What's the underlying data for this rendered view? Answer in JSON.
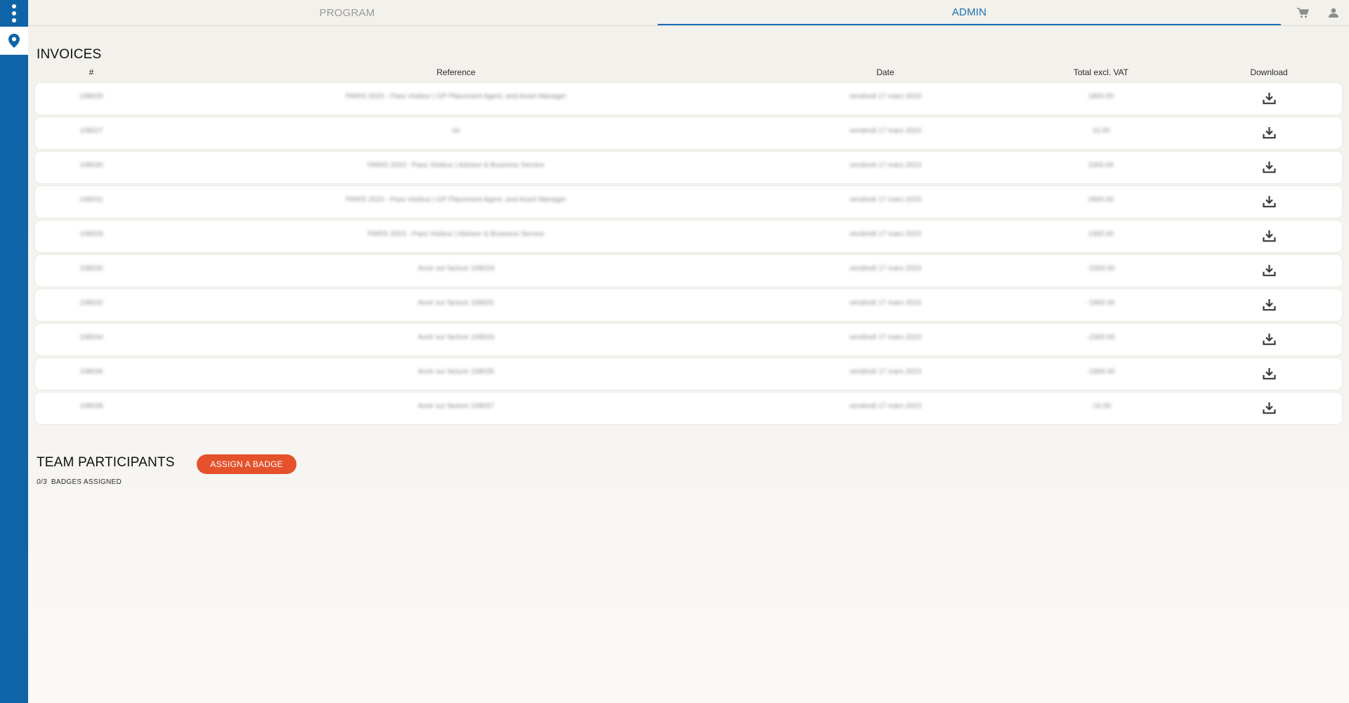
{
  "nav": {
    "program_label": "PROGRAM",
    "admin_label": "ADMIN",
    "active_tab": "ADMIN",
    "icons": [
      "more-vertical-icon",
      "map-pin-icon",
      "cart-icon",
      "user-icon"
    ]
  },
  "colors": {
    "rail": "#0f64a8",
    "accent": "#1a6fb5",
    "button": "#e5512b",
    "background": "#f3f1ec"
  },
  "invoices": {
    "title": "INVOICES",
    "columns": {
      "number": "#",
      "reference": "Reference",
      "date": "Date",
      "total": "Total excl. VAT",
      "download": "Download"
    },
    "rows": [
      {
        "number": "108026",
        "reference": "PARIS 2023 - Pass Visiteur | GP Placement Agent, and Asset Manager",
        "date": "vendredi 17 mars 2023",
        "total": "1800.00"
      },
      {
        "number": "108027",
        "reference": "lot",
        "date": "vendredi 17 mars 2023",
        "total": "10.00"
      },
      {
        "number": "108030",
        "reference": "PARIS 2023 - Pass Visiteur | Advisor & Business Service",
        "date": "vendredi 17 mars 2023",
        "total": "2300.00"
      },
      {
        "number": "108031",
        "reference": "PARIS 2023 - Pass Visiteur | GP Placement Agent, and Asset Manager",
        "date": "vendredi 17 mars 2023",
        "total": "2800.00"
      },
      {
        "number": "108029",
        "reference": "PARIS 2023 - Pass Visiteur | Advisor & Business Service",
        "date": "vendredi 17 mars 2023",
        "total": "2300.00"
      },
      {
        "number": "108030",
        "reference": "Avoir sur facture 108029",
        "date": "vendredi 17 mars 2023",
        "total": "-2300.00"
      },
      {
        "number": "108032",
        "reference": "Avoir sur facture 108031",
        "date": "vendredi 17 mars 2023",
        "total": "-1800.00"
      },
      {
        "number": "108034",
        "reference": "Avoir sur facture 108033",
        "date": "vendredi 17 mars 2023",
        "total": "-2300.00"
      },
      {
        "number": "108036",
        "reference": "Avoir sur facture 108035",
        "date": "vendredi 17 mars 2023",
        "total": "-1800.00"
      },
      {
        "number": "108038",
        "reference": "Avoir sur facture 108037",
        "date": "vendredi 17 mars 2023",
        "total": "-10.00"
      }
    ]
  },
  "team": {
    "title": "TEAM PARTICIPANTS",
    "assign_label": "ASSIGN A BADGE",
    "badges_count": "0/3",
    "badges_label": "BADGES ASSIGNED"
  }
}
